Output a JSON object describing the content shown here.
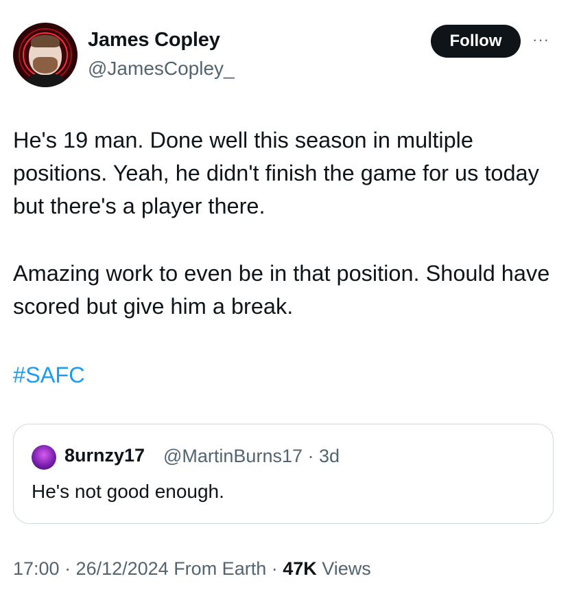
{
  "author": {
    "name": "James Copley",
    "handle": "@JamesCopley_",
    "follow_label": "Follow",
    "more_icon": "···"
  },
  "tweet": {
    "paragraphs": [
      "He's 19 man. Done well this season in multiple positions. Yeah, he didn't finish the game for us today but there's a player there.",
      "Amazing work to even be in that position. Should have scored but give him a break."
    ],
    "hashtag": "#SAFC"
  },
  "quoted": {
    "name": "8urnzy17",
    "meta": "@MartinBurns17 · 3d",
    "text": "He's not good enough."
  },
  "footer": {
    "time_date": "17:00 · 26/12/2024 From Earth · ",
    "views_count": "47K",
    "views_label": " Views"
  },
  "colors": {
    "text": "#0f1419",
    "secondary": "#536471",
    "link": "#1d9bf0",
    "border": "#cfd9de"
  }
}
